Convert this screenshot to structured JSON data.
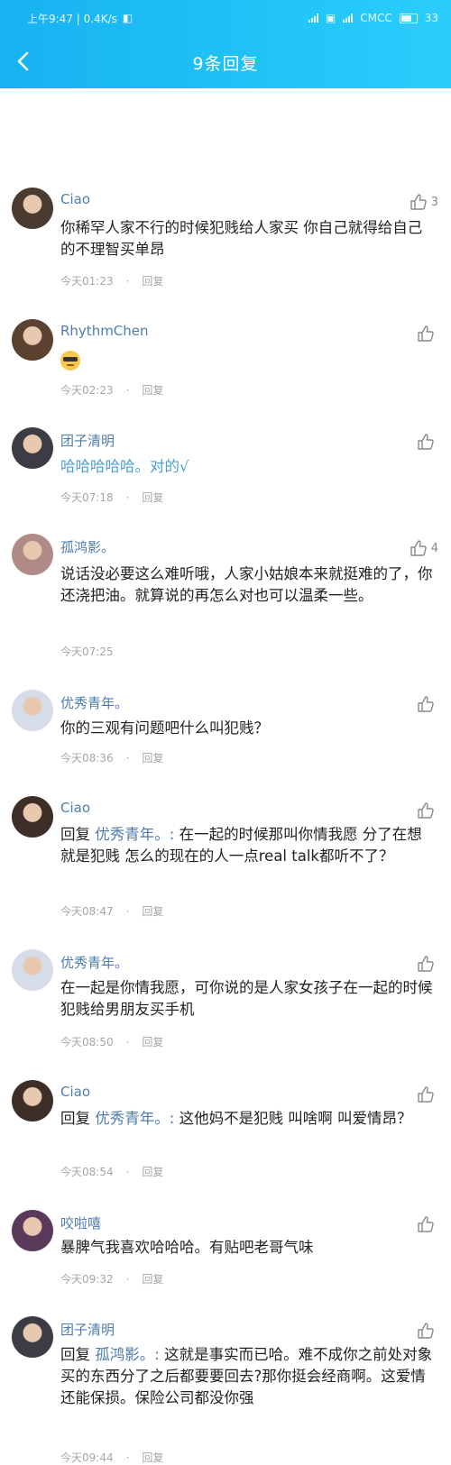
{
  "status_bar": {
    "time_speed": "上午9:47 | 0.4K/s",
    "carrier": "CMCC",
    "battery": "33"
  },
  "header": {
    "title": "9条回复"
  },
  "comments": [
    {
      "username": "Ciao",
      "like_count": "3",
      "reply_prefix": "",
      "mention": "",
      "text": "你稀罕人家不行的时候犯贱给人家买 你自己就得给自己的不理智买单昂",
      "time": "今天01:23",
      "reply_label": "回复"
    },
    {
      "username": "RhythmChen",
      "like_count": "",
      "reply_prefix": "",
      "mention": "",
      "text": "",
      "emoji": "cool-face",
      "time": "今天02:23",
      "reply_label": "回复"
    },
    {
      "username": "团子清明",
      "like_count": "",
      "reply_prefix": "",
      "mention": "",
      "text": "哈哈哈哈哈。对的√",
      "time": "今天07:18",
      "reply_label": "回复"
    },
    {
      "username": "孤鸿影。",
      "like_count": "4",
      "reply_prefix": "",
      "mention": "",
      "text": "说话没必要这么难听哦，人家小姑娘本来就挺难的了，你还浇把油。就算说的再怎么对也可以温柔一些。",
      "time": "今天07:25",
      "reply_label": ""
    },
    {
      "username": "优秀青年。",
      "like_count": "",
      "reply_prefix": "",
      "mention": "",
      "text": "你的三观有问题吧什么叫犯贱？",
      "time": "今天08:36",
      "reply_label": "回复"
    },
    {
      "username": "Ciao",
      "like_count": "",
      "reply_prefix": "回复",
      "mention": "优秀青年。:",
      "text": "在一起的时候那叫你情我愿 分了在想就是犯贱  怎么的现在的人一点real talk都听不了？",
      "time": "今天08:47",
      "reply_label": "回复"
    },
    {
      "username": "优秀青年。",
      "like_count": "",
      "reply_prefix": "",
      "mention": "",
      "text": "在一起是你情我愿，可你说的是人家女孩子在一起的时候犯贱给男朋友买手机",
      "time": "今天08:50",
      "reply_label": "回复"
    },
    {
      "username": "Ciao",
      "like_count": "",
      "reply_prefix": "回复",
      "mention": "优秀青年。:",
      "text": "这他妈不是犯贱  叫啥啊  叫爱情昂？",
      "time": "今天08:54",
      "reply_label": "回复"
    },
    {
      "username": "咬啦嘻",
      "like_count": "",
      "reply_prefix": "",
      "mention": "",
      "text": "暴脾气我喜欢哈哈哈。有贴吧老哥气味",
      "time": "今天09:32",
      "reply_label": "回复"
    },
    {
      "username": "团子清明",
      "like_count": "",
      "reply_prefix": "回复",
      "mention": "孤鸿影。:",
      "text": "这就是事实而已哈。难不成你之前处对象买的东西分了之后都要要回去?那你挺会经商啊。这爱情还能保损。保险公司都没你强",
      "time": "今天09:44",
      "reply_label": "回复"
    }
  ],
  "colors": {
    "header_start": "#18b2f2",
    "header_end": "#2acdfb",
    "username": "#4e7cab",
    "meta": "#a6a6a6"
  }
}
